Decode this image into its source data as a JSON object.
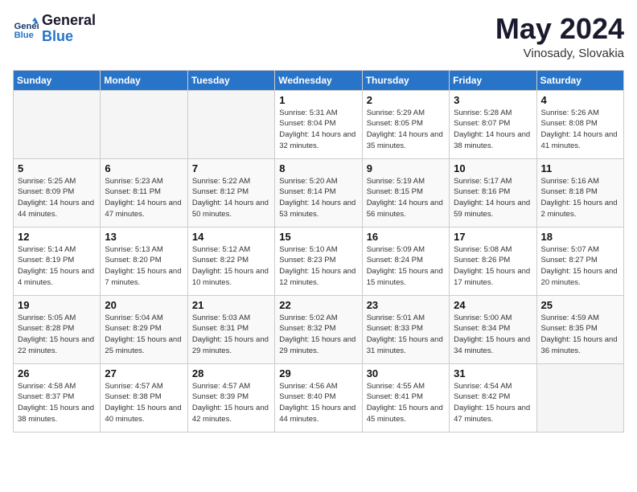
{
  "header": {
    "logo_line1": "General",
    "logo_line2": "Blue",
    "month_title": "May 2024",
    "location": "Vinosady, Slovakia"
  },
  "days_of_week": [
    "Sunday",
    "Monday",
    "Tuesday",
    "Wednesday",
    "Thursday",
    "Friday",
    "Saturday"
  ],
  "weeks": [
    [
      {
        "num": "",
        "sunrise": "",
        "sunset": "",
        "daylight": "",
        "empty": true
      },
      {
        "num": "",
        "sunrise": "",
        "sunset": "",
        "daylight": "",
        "empty": true
      },
      {
        "num": "",
        "sunrise": "",
        "sunset": "",
        "daylight": "",
        "empty": true
      },
      {
        "num": "1",
        "sunrise": "Sunrise: 5:31 AM",
        "sunset": "Sunset: 8:04 PM",
        "daylight": "Daylight: 14 hours and 32 minutes."
      },
      {
        "num": "2",
        "sunrise": "Sunrise: 5:29 AM",
        "sunset": "Sunset: 8:05 PM",
        "daylight": "Daylight: 14 hours and 35 minutes."
      },
      {
        "num": "3",
        "sunrise": "Sunrise: 5:28 AM",
        "sunset": "Sunset: 8:07 PM",
        "daylight": "Daylight: 14 hours and 38 minutes."
      },
      {
        "num": "4",
        "sunrise": "Sunrise: 5:26 AM",
        "sunset": "Sunset: 8:08 PM",
        "daylight": "Daylight: 14 hours and 41 minutes."
      }
    ],
    [
      {
        "num": "5",
        "sunrise": "Sunrise: 5:25 AM",
        "sunset": "Sunset: 8:09 PM",
        "daylight": "Daylight: 14 hours and 44 minutes."
      },
      {
        "num": "6",
        "sunrise": "Sunrise: 5:23 AM",
        "sunset": "Sunset: 8:11 PM",
        "daylight": "Daylight: 14 hours and 47 minutes."
      },
      {
        "num": "7",
        "sunrise": "Sunrise: 5:22 AM",
        "sunset": "Sunset: 8:12 PM",
        "daylight": "Daylight: 14 hours and 50 minutes."
      },
      {
        "num": "8",
        "sunrise": "Sunrise: 5:20 AM",
        "sunset": "Sunset: 8:14 PM",
        "daylight": "Daylight: 14 hours and 53 minutes."
      },
      {
        "num": "9",
        "sunrise": "Sunrise: 5:19 AM",
        "sunset": "Sunset: 8:15 PM",
        "daylight": "Daylight: 14 hours and 56 minutes."
      },
      {
        "num": "10",
        "sunrise": "Sunrise: 5:17 AM",
        "sunset": "Sunset: 8:16 PM",
        "daylight": "Daylight: 14 hours and 59 minutes."
      },
      {
        "num": "11",
        "sunrise": "Sunrise: 5:16 AM",
        "sunset": "Sunset: 8:18 PM",
        "daylight": "Daylight: 15 hours and 2 minutes."
      }
    ],
    [
      {
        "num": "12",
        "sunrise": "Sunrise: 5:14 AM",
        "sunset": "Sunset: 8:19 PM",
        "daylight": "Daylight: 15 hours and 4 minutes."
      },
      {
        "num": "13",
        "sunrise": "Sunrise: 5:13 AM",
        "sunset": "Sunset: 8:20 PM",
        "daylight": "Daylight: 15 hours and 7 minutes."
      },
      {
        "num": "14",
        "sunrise": "Sunrise: 5:12 AM",
        "sunset": "Sunset: 8:22 PM",
        "daylight": "Daylight: 15 hours and 10 minutes."
      },
      {
        "num": "15",
        "sunrise": "Sunrise: 5:10 AM",
        "sunset": "Sunset: 8:23 PM",
        "daylight": "Daylight: 15 hours and 12 minutes."
      },
      {
        "num": "16",
        "sunrise": "Sunrise: 5:09 AM",
        "sunset": "Sunset: 8:24 PM",
        "daylight": "Daylight: 15 hours and 15 minutes."
      },
      {
        "num": "17",
        "sunrise": "Sunrise: 5:08 AM",
        "sunset": "Sunset: 8:26 PM",
        "daylight": "Daylight: 15 hours and 17 minutes."
      },
      {
        "num": "18",
        "sunrise": "Sunrise: 5:07 AM",
        "sunset": "Sunset: 8:27 PM",
        "daylight": "Daylight: 15 hours and 20 minutes."
      }
    ],
    [
      {
        "num": "19",
        "sunrise": "Sunrise: 5:05 AM",
        "sunset": "Sunset: 8:28 PM",
        "daylight": "Daylight: 15 hours and 22 minutes."
      },
      {
        "num": "20",
        "sunrise": "Sunrise: 5:04 AM",
        "sunset": "Sunset: 8:29 PM",
        "daylight": "Daylight: 15 hours and 25 minutes."
      },
      {
        "num": "21",
        "sunrise": "Sunrise: 5:03 AM",
        "sunset": "Sunset: 8:31 PM",
        "daylight": "Daylight: 15 hours and 29 minutes."
      },
      {
        "num": "22",
        "sunrise": "Sunrise: 5:02 AM",
        "sunset": "Sunset: 8:32 PM",
        "daylight": "Daylight: 15 hours and 29 minutes."
      },
      {
        "num": "23",
        "sunrise": "Sunrise: 5:01 AM",
        "sunset": "Sunset: 8:33 PM",
        "daylight": "Daylight: 15 hours and 31 minutes."
      },
      {
        "num": "24",
        "sunrise": "Sunrise: 5:00 AM",
        "sunset": "Sunset: 8:34 PM",
        "daylight": "Daylight: 15 hours and 34 minutes."
      },
      {
        "num": "25",
        "sunrise": "Sunrise: 4:59 AM",
        "sunset": "Sunset: 8:35 PM",
        "daylight": "Daylight: 15 hours and 36 minutes."
      }
    ],
    [
      {
        "num": "26",
        "sunrise": "Sunrise: 4:58 AM",
        "sunset": "Sunset: 8:37 PM",
        "daylight": "Daylight: 15 hours and 38 minutes."
      },
      {
        "num": "27",
        "sunrise": "Sunrise: 4:57 AM",
        "sunset": "Sunset: 8:38 PM",
        "daylight": "Daylight: 15 hours and 40 minutes."
      },
      {
        "num": "28",
        "sunrise": "Sunrise: 4:57 AM",
        "sunset": "Sunset: 8:39 PM",
        "daylight": "Daylight: 15 hours and 42 minutes."
      },
      {
        "num": "29",
        "sunrise": "Sunrise: 4:56 AM",
        "sunset": "Sunset: 8:40 PM",
        "daylight": "Daylight: 15 hours and 44 minutes."
      },
      {
        "num": "30",
        "sunrise": "Sunrise: 4:55 AM",
        "sunset": "Sunset: 8:41 PM",
        "daylight": "Daylight: 15 hours and 45 minutes."
      },
      {
        "num": "31",
        "sunrise": "Sunrise: 4:54 AM",
        "sunset": "Sunset: 8:42 PM",
        "daylight": "Daylight: 15 hours and 47 minutes."
      },
      {
        "num": "",
        "sunrise": "",
        "sunset": "",
        "daylight": "",
        "empty": true
      }
    ]
  ]
}
